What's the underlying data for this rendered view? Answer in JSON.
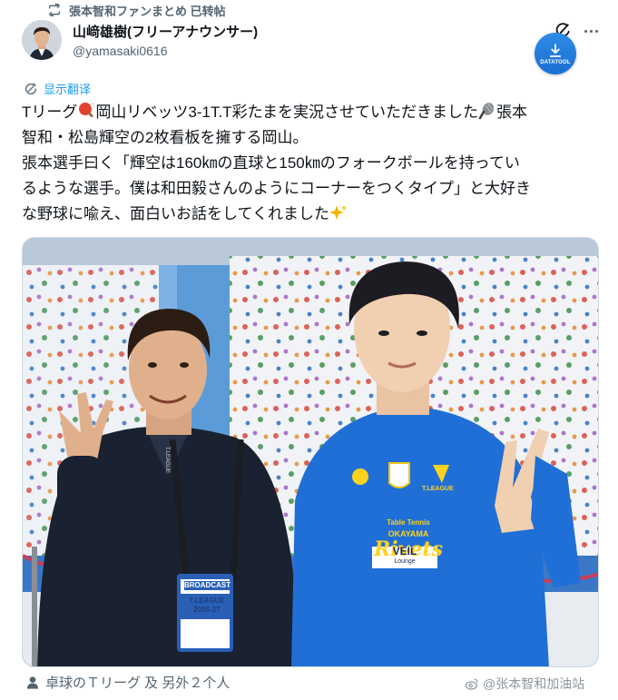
{
  "repost": {
    "label": "張本智和ファンまとめ 已转帖",
    "icon": "repost-icon"
  },
  "author": {
    "name": "山﨑雄樹(フリーアナウンサー)",
    "handle": "@yamasaki0616",
    "avatar": "avatar-photo"
  },
  "header_icons": {
    "grok": "grok-icon",
    "more": "more-icon"
  },
  "download_badge": {
    "label": "DATATOOL",
    "icon": "download-icon"
  },
  "translate": {
    "label": "显示翻译",
    "icon": "translate-icon"
  },
  "tweet": {
    "line1a": "Tリーグ",
    "line1b": "岡山リベッツ3-1T.T彩たまを実況させていただきました",
    "line1c": "張本",
    "line2": "智和・松島輝空の2枚看板を擁する岡山。",
    "line3": "張本選手曰く「輝空は160㎞の直球と150㎞のフォークボールを持ってい",
    "line4": "るような選手。僕は和田毅さんのようにコーナーをつくタイプ」と大好き",
    "line5": "な野球に喩え、面白いお話をしてくれました"
  },
  "photo": {
    "alt_badge": "BROADCAST",
    "badge_sub": "T.LEAGUE",
    "badge_season": "2026-27",
    "lanyard_text": "T.LEAGUE",
    "shirt_club_small": "Table Tennis",
    "shirt_city": "OKAYAMA",
    "shirt_team": "Rivets",
    "shirt_sponsor": "VEIL",
    "shirt_sponsor_sub": "Lounge",
    "shirt_league": "T.LEAGUE"
  },
  "bottom": {
    "tagged": "卓球のＴリーグ 及 另外２个人",
    "icon": "person-icon"
  },
  "watermark": {
    "label": "@张本智和加油站",
    "icon": "weibo-icon"
  },
  "colors": {
    "accent": "#1d9bf0",
    "muted": "#536471",
    "text": "#0f1419",
    "jersey": "#1f6fd6"
  }
}
